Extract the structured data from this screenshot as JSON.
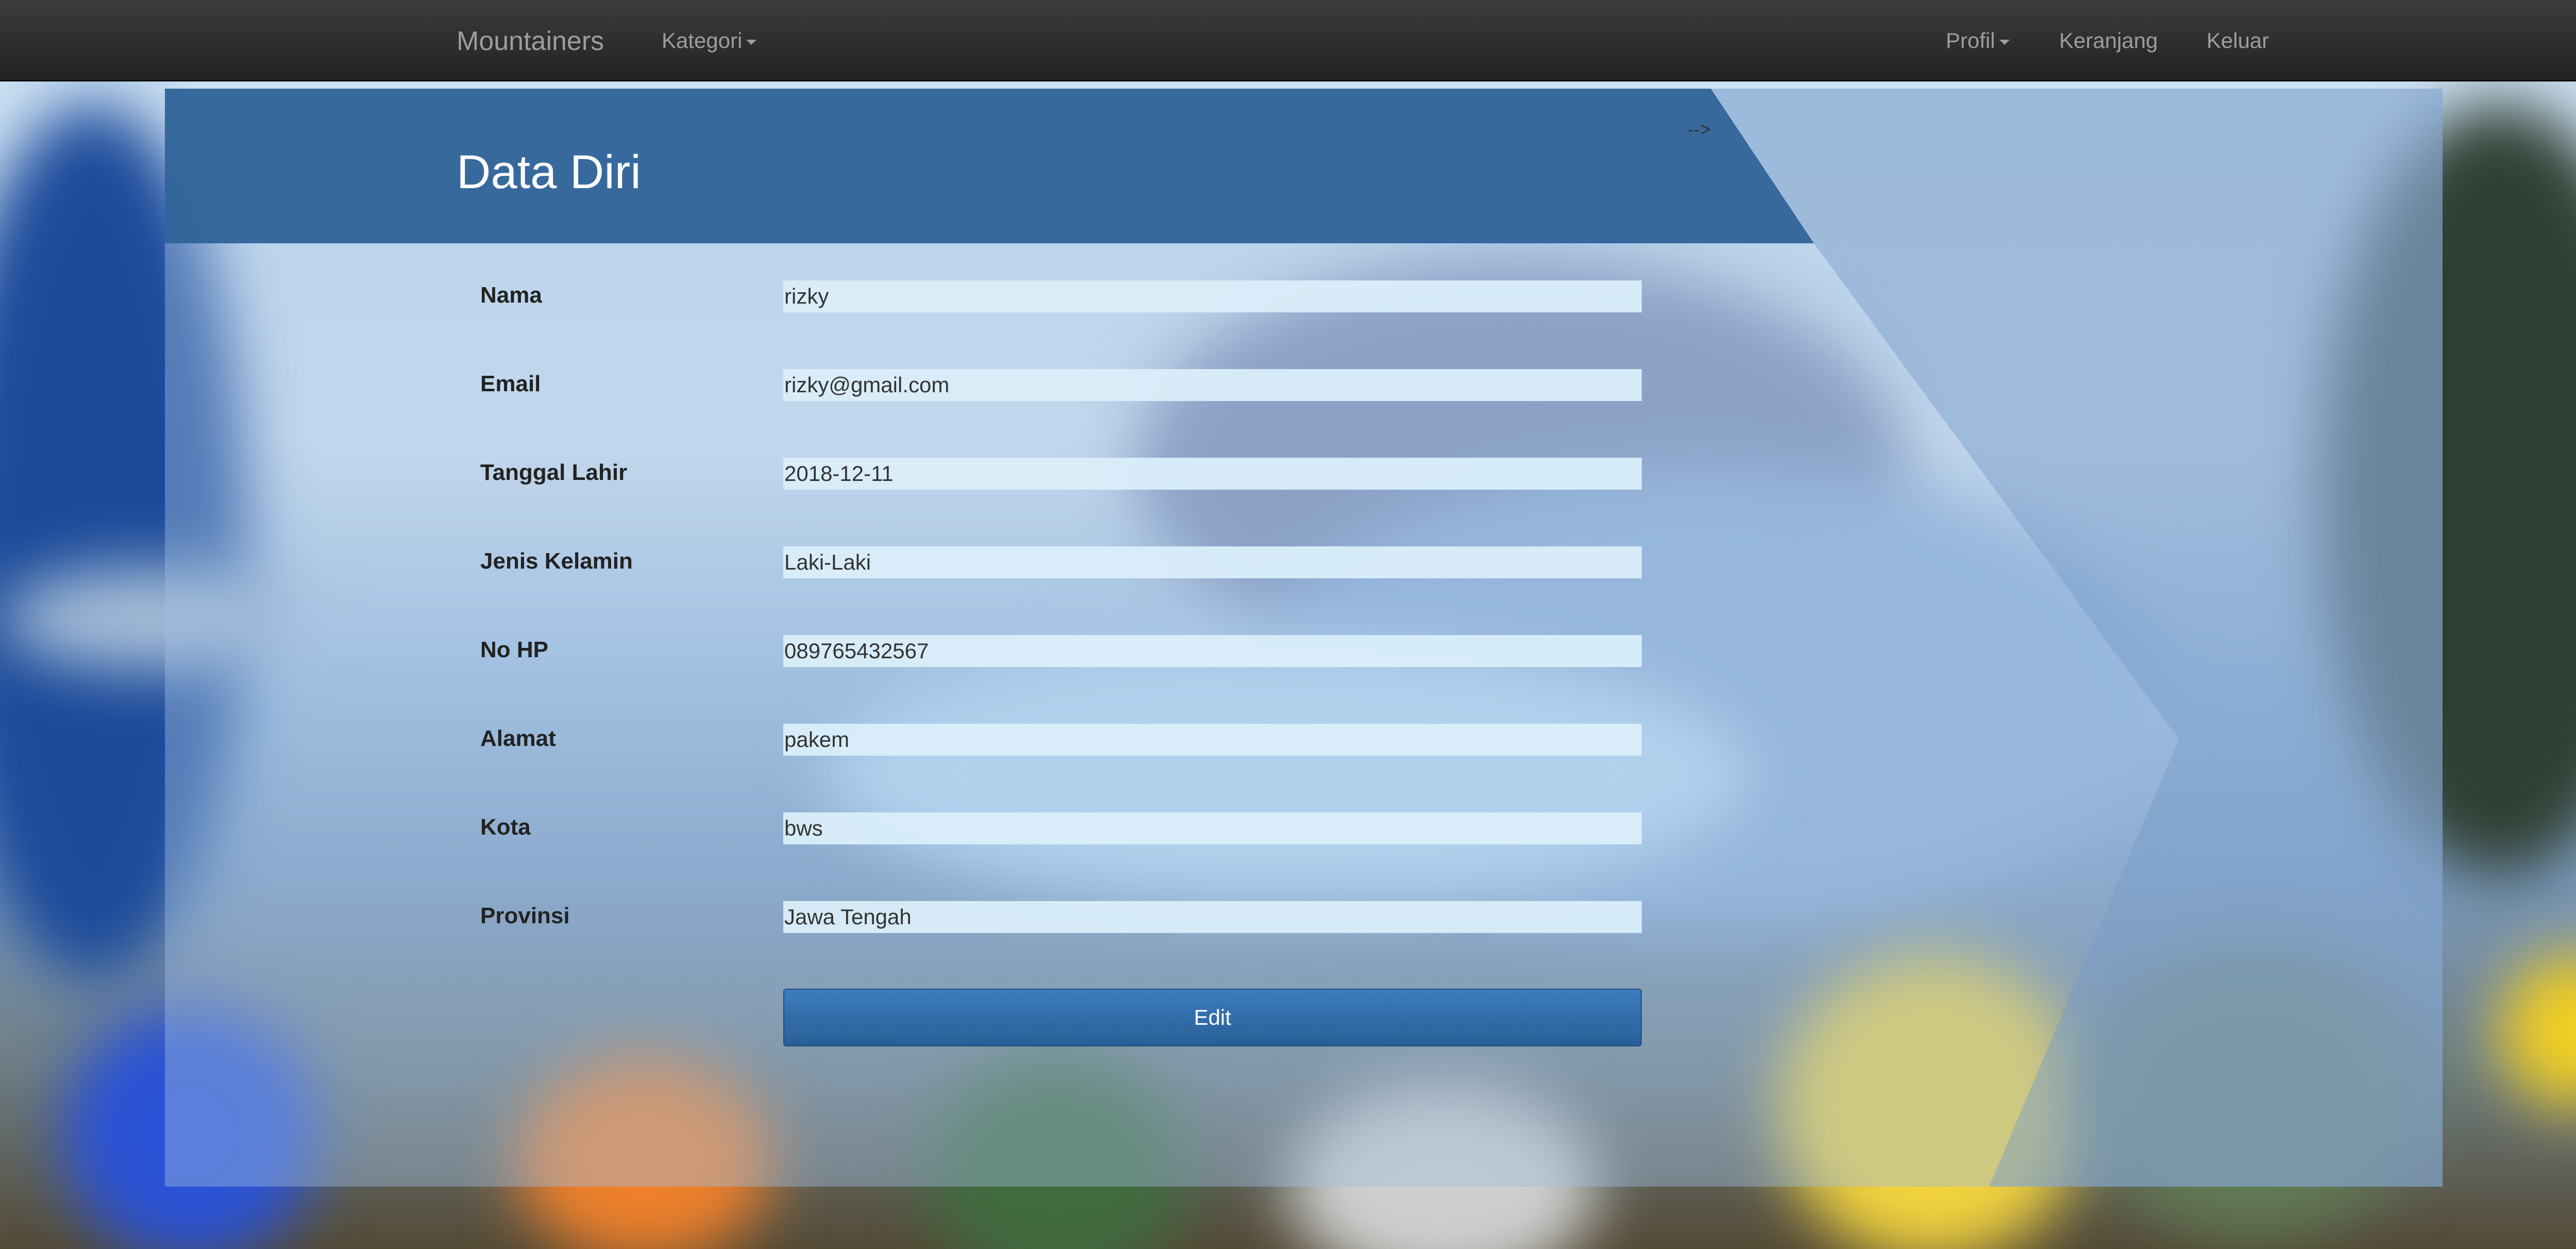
{
  "navbar": {
    "brand": "Mountainers",
    "kategori": "Kategori",
    "profil": "Profil",
    "keranjang": "Keranjang",
    "keluar": "Keluar"
  },
  "panel": {
    "title": "Data Diri",
    "stray_text": "-->",
    "fields": [
      {
        "label": "Nama",
        "value": "rizky"
      },
      {
        "label": "Email",
        "value": "rizky@gmail.com"
      },
      {
        "label": "Tanggal Lahir",
        "value": "2018-12-11"
      },
      {
        "label": "Jenis Kelamin",
        "value": "Laki-Laki"
      },
      {
        "label": "No HP",
        "value": "089765432567"
      },
      {
        "label": "Alamat",
        "value": "pakem"
      },
      {
        "label": "Kota",
        "value": "bws"
      },
      {
        "label": "Provinsi",
        "value": "Jawa Tengah"
      }
    ],
    "edit_label": "Edit"
  },
  "colors": {
    "navbar": "#222222",
    "header_band": "#2f6399",
    "button": "#2d6aa8",
    "input_bg": "#daeefa"
  }
}
